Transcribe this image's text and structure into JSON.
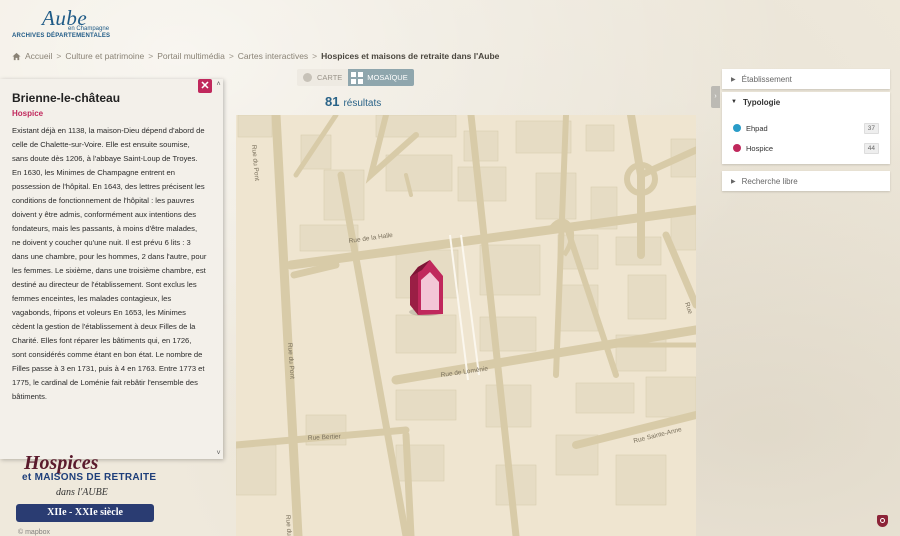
{
  "logo": {
    "name": "Aube",
    "sub": "en Champagne",
    "archives": "ARCHIVES DÉPARTEMENTALES"
  },
  "breadcrumb": {
    "items": [
      "Accueil",
      "Culture et patrimoine",
      "Portail multimédia",
      "Cartes interactives"
    ],
    "current": "Hospices et maisons de retraite dans l'Aube"
  },
  "view_toggle": {
    "carte": "CARTE",
    "mosaique": "MOSAÏQUE",
    "active": "mosaique"
  },
  "results": {
    "count": "81",
    "label": "résultats"
  },
  "info": {
    "title": "Brienne-le-château",
    "type": "Hospice",
    "text": "Existant déjà en 1138, la maison-Dieu dépend d'abord de celle de Chalette-sur-Voire. Elle est ensuite soumise, sans doute dès 1206, à l'abbaye Saint-Loup de Troyes. En 1630, les Minimes de Champagne entrent en possession de l'hôpital. En 1643, des lettres précisent les conditions de fonctionnement de l'hôpital : les pauvres doivent y être admis, conformément aux intentions des fondateurs, mais les passants, à moins d'être malades, ne doivent y coucher qu'une nuit. Il est prévu 6 lits : 3 dans une chambre, pour les hommes, 2 dans l'autre, pour les femmes. Le sixième, dans une troisième chambre, est destiné au directeur de l'établissement. Sont exclus les femmes enceintes, les malades contagieux, les vagabonds, fripons et voleurs En 1653, les Minimes cèdent la gestion de l'établissement à deux Filles de la Charité. Elles font réparer les bâtiments qui, en 1726, sont considérés comme étant en bon état. Le nombre de Filles passe à 3 en 1731, puis à 4 en 1763. Entre 1773 et 1775, le cardinal de Loménie fait rebâtir l'ensemble des bâtiments."
  },
  "map": {
    "streets": {
      "rue_de_la_halle": "Rue de la Halle",
      "rue_du_pont": "Rue du Pont",
      "rue_de_lomenie": "Rue de Loménie",
      "rue_bertier": "Rue Bertier",
      "rue_sainte_anne": "Rue Sainte-Anne",
      "rue_right": "Rue"
    },
    "land_color": "#efe5d0",
    "road_color": "#dccfae",
    "building_color": "#e6dcc4",
    "marker_color": "#c0285c"
  },
  "decor": {
    "line1": "Hospices",
    "line2": "et MAISONS DE RETRAITE",
    "line3": "dans l'AUBE",
    "line4": "XIIe - XXIe siècle",
    "attribution": "© mapbox"
  },
  "filters": {
    "etablissement": "Établissement",
    "typologie": "Typologie",
    "recherche": "Recherche libre",
    "types": [
      {
        "label": "Ehpad",
        "count": "37",
        "color": "#2a9cc8"
      },
      {
        "label": "Hospice",
        "count": "44",
        "color": "#c0285c"
      }
    ]
  }
}
